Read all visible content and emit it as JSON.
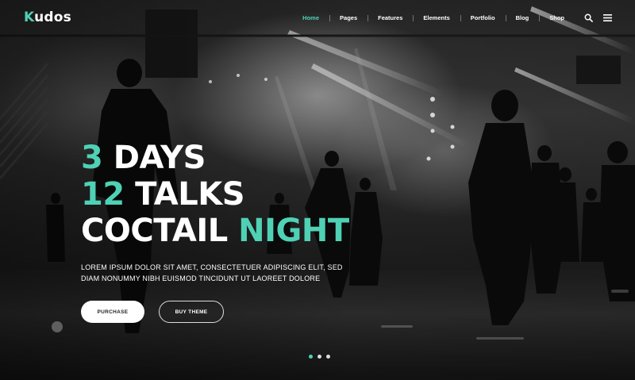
{
  "brand": {
    "logo_first": "K",
    "logo_rest": "udos",
    "accent_color": "#4fd1b5"
  },
  "nav": {
    "items": [
      {
        "label": "Home",
        "active": true
      },
      {
        "label": "Pages"
      },
      {
        "label": "Features"
      },
      {
        "label": "Elements"
      },
      {
        "label": "Portfolio"
      },
      {
        "label": "Blog"
      },
      {
        "label": "Shop"
      }
    ],
    "icons": [
      "search-icon",
      "menu-icon"
    ]
  },
  "hero": {
    "line1_accent": "3",
    "line1_rest": "DAYS",
    "line2_accent": "12",
    "line2_rest": "TALKS",
    "line3_white": "COCTAIL",
    "line3_accent": "NIGHT",
    "description_line1": "LOREM IPSUM DOLOR SIT AMET, CONSECTETUER ADIPISCING ELIT, SED",
    "description_line2": "DIAM NONUMMY NIBH EUISMOD TINCIDUNT UT LAOREET DOLORE",
    "purchase_label": "PURCHASE",
    "buy_label": "BUY THEME"
  },
  "slider": {
    "dot_count": 3,
    "active_index": 0
  }
}
